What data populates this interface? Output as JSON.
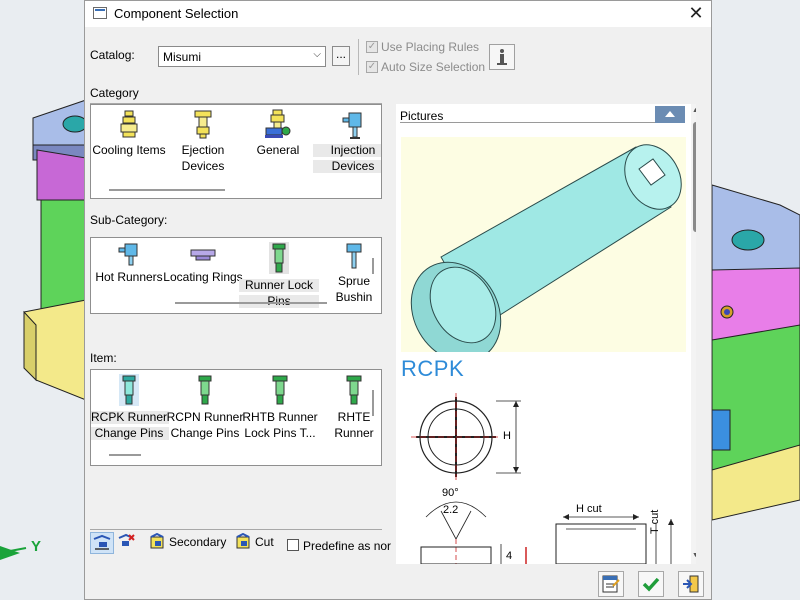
{
  "window": {
    "title": "Component Selection"
  },
  "catalog": {
    "label": "Catalog:",
    "value": "Misumi",
    "browse": "..."
  },
  "options": {
    "placing_rules": "Use Placing Rules",
    "auto_size": "Auto Size Selection"
  },
  "category": {
    "label": "Category",
    "items": [
      {
        "line1": "Cooling Items",
        "line2": ""
      },
      {
        "line1": "Ejection",
        "line2": "Devices"
      },
      {
        "line1": "General",
        "line2": ""
      },
      {
        "line1": "Injection",
        "line2": "Devices"
      }
    ]
  },
  "subcategory": {
    "label": "Sub-Category:",
    "items": [
      {
        "line1": "Hot Runners",
        "line2": ""
      },
      {
        "line1": "Locating Rings",
        "line2": ""
      },
      {
        "line1": "Runner Lock",
        "line2": "Pins"
      },
      {
        "line1": "Sprue",
        "line2": "Bushin"
      }
    ]
  },
  "item": {
    "label": "Item:",
    "items": [
      {
        "line1": "RCPK Runner",
        "line2": "Change Pins"
      },
      {
        "line1": "RCPN Runner",
        "line2": "Change Pins"
      },
      {
        "line1": "RHTB Runner",
        "line2": "Lock Pins T..."
      },
      {
        "line1": "RHTE",
        "line2": "Runner"
      }
    ]
  },
  "toolbar": {
    "secondary": "Secondary",
    "cut": "Cut",
    "predefine": "Predefine as nor"
  },
  "pictures": {
    "label": "Pictures",
    "part_name": "RCPK",
    "dims": {
      "h": "H",
      "angle": "90°",
      "width": "2.2",
      "h_cut": "H cut",
      "t_cut": "T cut",
      "four": "4"
    }
  },
  "axis": {
    "y_label": "Y"
  },
  "colors": {
    "accent": "#2e8bd8",
    "ok": "#1f9d3a",
    "tile_selected": "#e9e9e9",
    "pic_bg": "#fdfde3",
    "part": "#9fe8e4"
  }
}
